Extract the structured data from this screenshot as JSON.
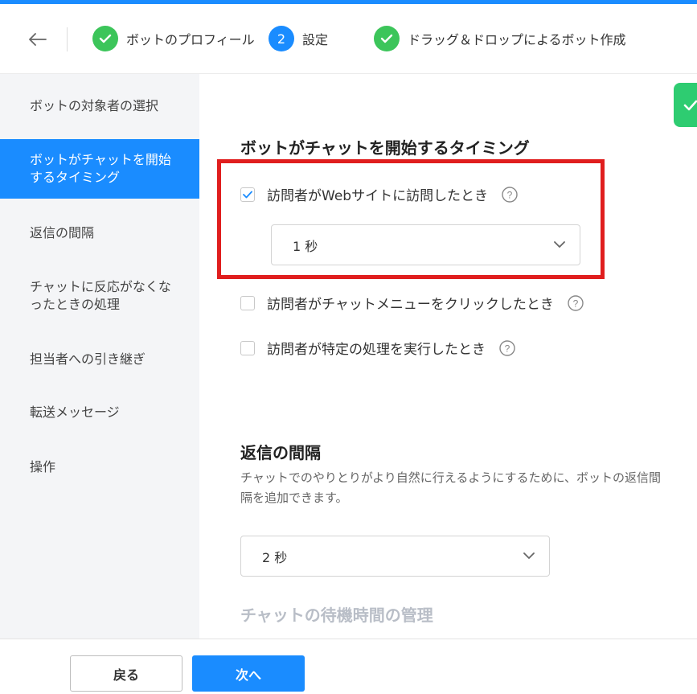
{
  "header": {
    "steps": [
      {
        "number": "",
        "label": "ボットのプロフィール",
        "status": "done"
      },
      {
        "number": "2",
        "label": "設定",
        "status": "active"
      },
      {
        "number": "",
        "label": "ドラッグ＆ドロップによるボット作成",
        "status": "done"
      }
    ]
  },
  "sidebar": {
    "items": [
      {
        "label": "ボットの対象者の選択"
      },
      {
        "label": "ボットがチャットを開始するタイミング"
      },
      {
        "label": "返信の間隔"
      },
      {
        "label": "チャットに反応がなくなったときの処理"
      },
      {
        "label": "担当者への引き継ぎ"
      },
      {
        "label": "転送メッセージ"
      },
      {
        "label": "操作"
      }
    ]
  },
  "main": {
    "timing_section": {
      "title": "ボットがチャットを開始するタイミング",
      "options": [
        {
          "label": "訪問者がWebサイトに訪問したとき",
          "checked": true
        },
        {
          "label": "訪問者がチャットメニューをクリックしたとき",
          "checked": false
        },
        {
          "label": "訪問者が特定の処理を実行したとき",
          "checked": false
        }
      ],
      "delay_value": "1 秒"
    },
    "reply_section": {
      "title": "返信の間隔",
      "description": "チャットでのやりとりがより自然に行えるようにするために、ボットの返信間隔を追加できます。",
      "interval_value": "2 秒"
    },
    "wait_section": {
      "title": "チャットの待機時間の管理"
    }
  },
  "footer": {
    "back_label": "戻る",
    "next_label": "次へ"
  },
  "colors": {
    "accent": "#1a8cff",
    "success": "#3cc55a",
    "highlight": "#e01e1e"
  }
}
